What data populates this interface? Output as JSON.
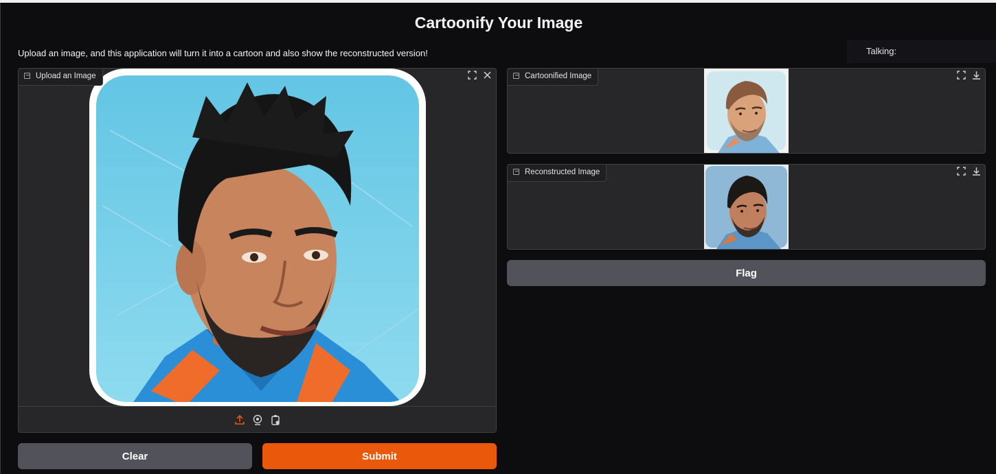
{
  "app": {
    "title": "Cartoonify Your Image",
    "description": "Upload an image, and this application will turn it into a cartoon and also show the reconstructed version!",
    "talking_label": "Talking:"
  },
  "input_panel": {
    "label": "Upload an Image",
    "label_icon": "image-icon",
    "tools": [
      "fullscreen-icon",
      "close-icon"
    ],
    "sources": [
      "upload-icon",
      "webcam-icon",
      "clipboard-icon"
    ],
    "active_source": "upload-icon"
  },
  "output_cartoon": {
    "label": "Cartoonified Image",
    "label_icon": "image-icon",
    "tools": [
      "fullscreen-icon",
      "download-icon"
    ]
  },
  "output_reconstructed": {
    "label": "Reconstructed Image",
    "label_icon": "image-icon",
    "tools": [
      "fullscreen-icon",
      "download-icon"
    ]
  },
  "buttons": {
    "clear": "Clear",
    "submit": "Submit",
    "flag": "Flag"
  },
  "colors": {
    "accent": "#ea580c",
    "secondary": "#52525b",
    "panel": "#27272a",
    "background": "#0b0b0f"
  }
}
